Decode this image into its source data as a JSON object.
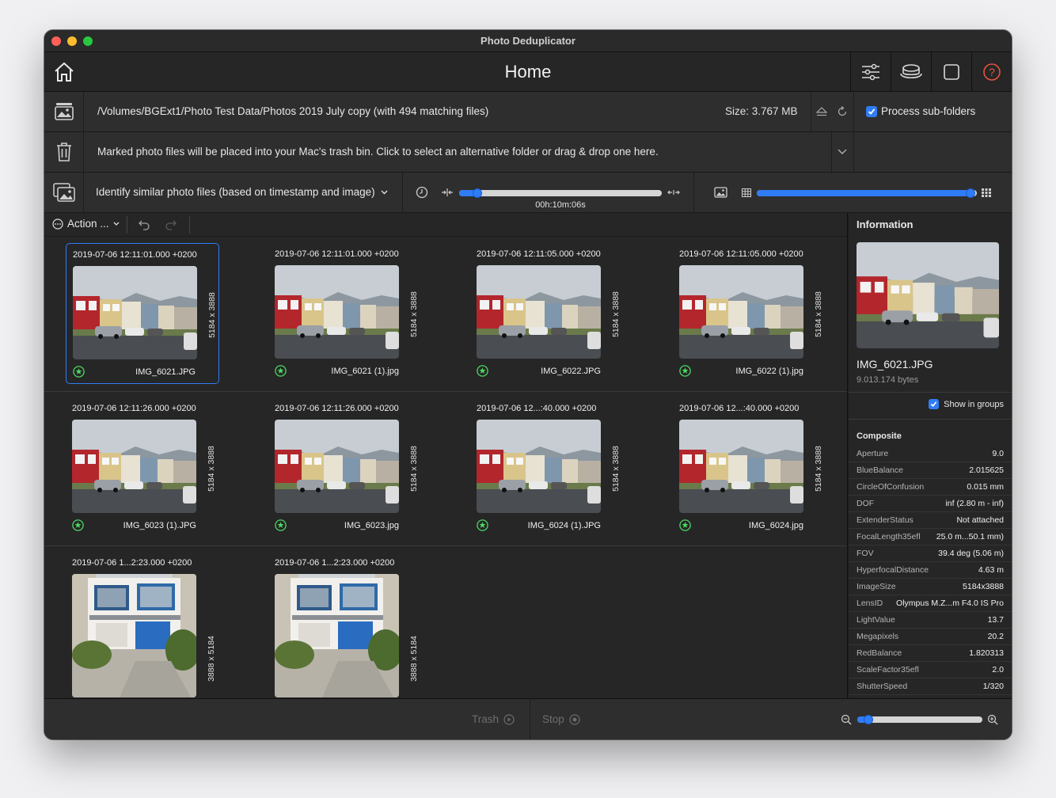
{
  "window": {
    "title": "Photo Deduplicator"
  },
  "toolbar": {
    "title": "Home"
  },
  "source": {
    "path": "/Volumes/BGExt1/Photo Test Data/Photos 2019 July copy (with 494 matching files)",
    "size": "Size: 3.767 MB",
    "subfolders_label": "Process sub-folders",
    "subfolders_checked": true
  },
  "trash_row": {
    "text": "Marked photo files will be placed into your Mac's trash bin.  Click to select an alternative folder or drag & drop one here."
  },
  "mode_row": {
    "mode": "Identify similar photo files (based on timestamp and image)",
    "time_value": "00h:10m:06s",
    "time_slider_fraction": 0.09,
    "similarity_slider_fraction": 0.97
  },
  "action_bar": {
    "action_label": "Action ..."
  },
  "groups": [
    {
      "items": [
        {
          "timestamp": "2019-07-06 12:11:01.000 +0200",
          "dims": "5184 x 3888",
          "filename": "IMG_6021.JPG",
          "selected": true,
          "kind": "street"
        },
        {
          "timestamp": "2019-07-06 12:11:01.000 +0200",
          "dims": "5184 x 3888",
          "filename": "IMG_6021 (1).jpg",
          "kind": "street"
        },
        {
          "timestamp": "2019-07-06 12:11:05.000 +0200",
          "dims": "5184 x 3888",
          "filename": "IMG_6022.JPG",
          "kind": "street"
        },
        {
          "timestamp": "2019-07-06 12:11:05.000 +0200",
          "dims": "5184 x 3888",
          "filename": "IMG_6022 (1).jpg",
          "kind": "street"
        }
      ]
    },
    {
      "items": [
        {
          "timestamp": "2019-07-06 12:11:26.000 +0200",
          "dims": "5184 x 3888",
          "filename": "IMG_6023 (1).JPG",
          "kind": "street"
        },
        {
          "timestamp": "2019-07-06 12:11:26.000 +0200",
          "dims": "5184 x 3888",
          "filename": "IMG_6023.jpg",
          "kind": "street"
        },
        {
          "timestamp": "2019-07-06 12...:40.000 +0200",
          "dims": "5184 x 3888",
          "filename": "IMG_6024 (1).JPG",
          "kind": "street"
        },
        {
          "timestamp": "2019-07-06 12...:40.000 +0200",
          "dims": "5184 x 3888",
          "filename": "IMG_6024.jpg",
          "kind": "street"
        }
      ]
    },
    {
      "items": [
        {
          "timestamp": "2019-07-06 1...2:23.000 +0200",
          "dims": "3888 x 5184",
          "filename": "",
          "kind": "house"
        },
        {
          "timestamp": "2019-07-06 1...2:23.000 +0200",
          "dims": "3888 x 5184",
          "filename": "",
          "kind": "house"
        }
      ]
    }
  ],
  "info": {
    "title": "Information",
    "filename": "IMG_6021.JPG",
    "bytes": "9.013.174 bytes",
    "show_in_groups_label": "Show in groups",
    "show_in_groups_checked": true,
    "section": "Composite",
    "rows": [
      {
        "k": "Aperture",
        "v": "9.0"
      },
      {
        "k": "BlueBalance",
        "v": "2.015625"
      },
      {
        "k": "CircleOfConfusion",
        "v": "0.015 mm"
      },
      {
        "k": "DOF",
        "v": "inf (2.80 m - inf)"
      },
      {
        "k": "ExtenderStatus",
        "v": "Not attached"
      },
      {
        "k": "FocalLength35efl",
        "v": "25.0 m...50.1 mm)"
      },
      {
        "k": "FOV",
        "v": "39.4 deg (5.06 m)"
      },
      {
        "k": "HyperfocalDistance",
        "v": "4.63 m"
      },
      {
        "k": "ImageSize",
        "v": "5184x3888"
      },
      {
        "k": "LensID",
        "v": "Olympus M.Z...m F4.0 IS Pro"
      },
      {
        "k": "LightValue",
        "v": "13.7"
      },
      {
        "k": "Megapixels",
        "v": "20.2"
      },
      {
        "k": "RedBalance",
        "v": "1.820313"
      },
      {
        "k": "ScaleFactor35efl",
        "v": "2.0"
      },
      {
        "k": "ShutterSpeed",
        "v": "1/320"
      }
    ]
  },
  "bottom": {
    "trash_label": "Trash",
    "stop_label": "Stop",
    "zoom_fraction": 0.09
  },
  "colors": {
    "accent": "#2f7cf6",
    "star": "#4cd964",
    "help": "#e5533d"
  }
}
